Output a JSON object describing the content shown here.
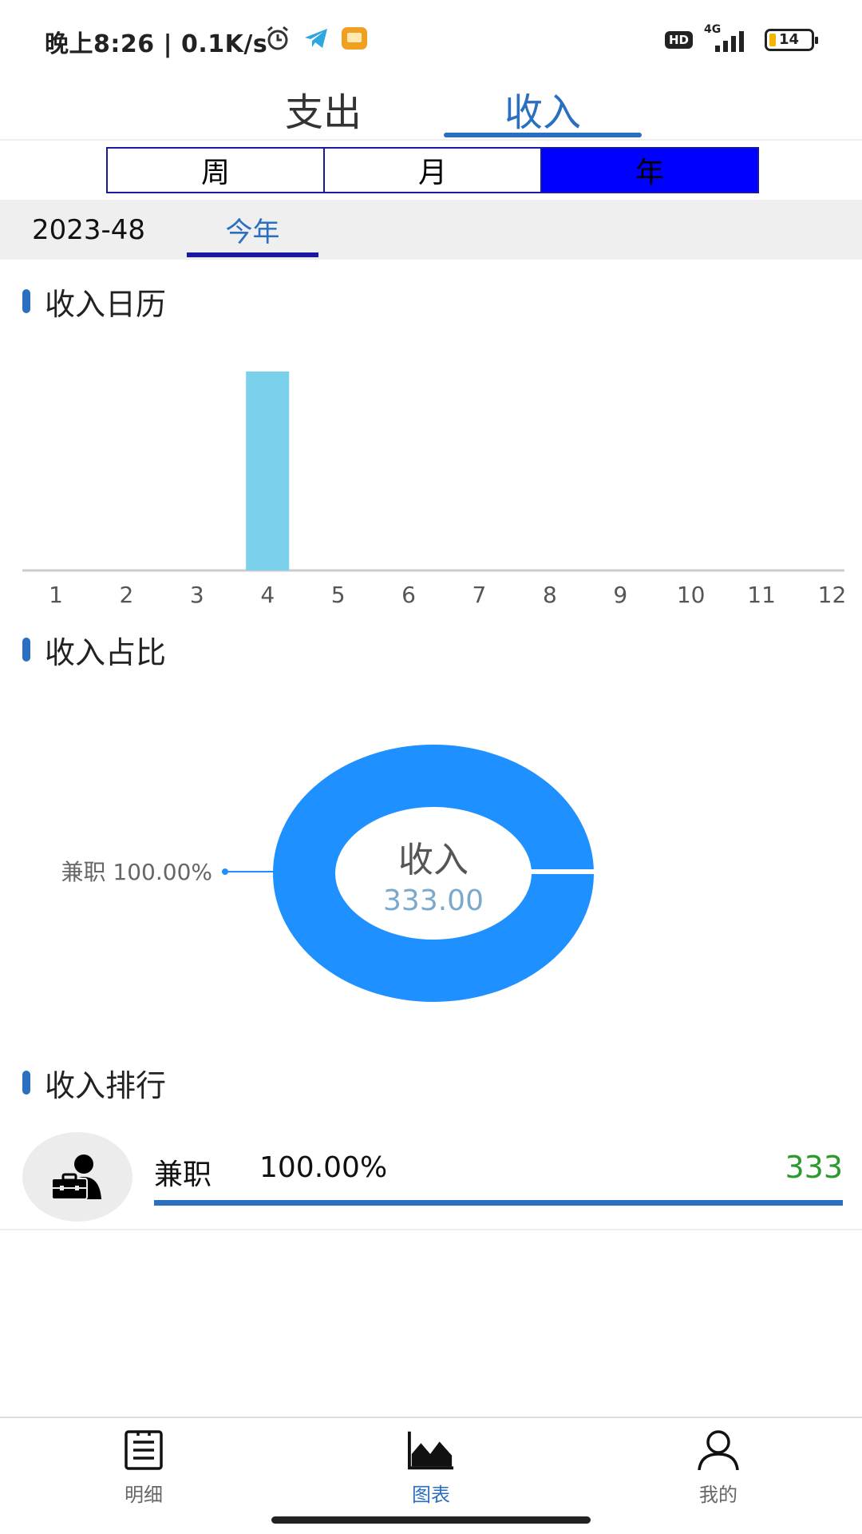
{
  "status_bar": {
    "time": "晚上8:26 | 0.1K/s",
    "network_badge": "HD",
    "signal_label": "4G",
    "battery_level": "14"
  },
  "type_tabs": {
    "expense": "支出",
    "income": "收入",
    "active": "income"
  },
  "period_tabs": {
    "items": [
      "周",
      "月",
      "年"
    ],
    "active_index": 2
  },
  "date_tabs": {
    "week": "2023-48",
    "year": "今年",
    "active": "year"
  },
  "sections": {
    "calendar": "收入日历",
    "ratio": "收入占比",
    "ranking": "收入排行"
  },
  "chart_data": [
    {
      "type": "bar",
      "categories": [
        "1",
        "2",
        "3",
        "4",
        "5",
        "6",
        "7",
        "8",
        "9",
        "10",
        "11",
        "12"
      ],
      "values": [
        0,
        0,
        0,
        333,
        0,
        0,
        0,
        0,
        0,
        0,
        0,
        0
      ],
      "title": "",
      "xlabel": "",
      "ylabel": "",
      "grid": false,
      "color": "#7bd0ec"
    },
    {
      "type": "pie",
      "labels": [
        "兼职"
      ],
      "values": [
        100.0
      ],
      "slice_label": "兼职 100.00%",
      "center_title": "收入",
      "center_value": "333.00",
      "hole": true,
      "color": "#1e90ff"
    }
  ],
  "ranking": [
    {
      "name": "兼职",
      "percent_text": "100.00%",
      "amount": "333",
      "progress": 1.0,
      "icon": "briefcase-person-icon"
    }
  ],
  "bottom_nav": {
    "items": [
      {
        "label": "明细",
        "icon": "list-icon"
      },
      {
        "label": "图表",
        "icon": "chart-icon"
      },
      {
        "label": "我的",
        "icon": "user-icon"
      }
    ],
    "active_index": 1
  },
  "colors": {
    "accent": "#2a6fc0",
    "period_active": "#0000ff",
    "amount_green": "#2a9a2a"
  }
}
